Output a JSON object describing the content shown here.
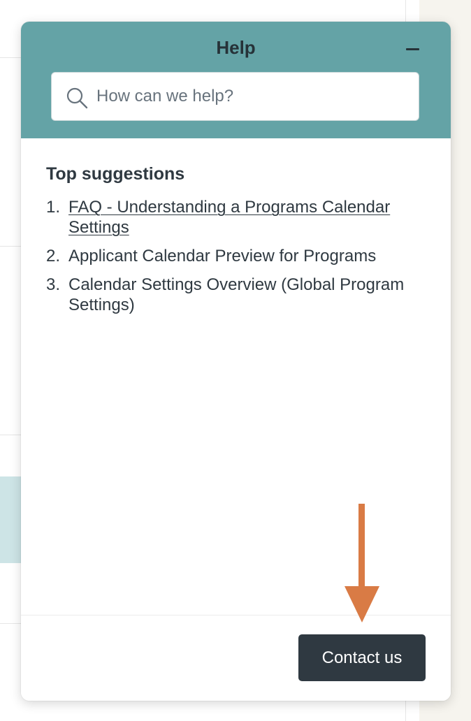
{
  "help_widget": {
    "title": "Help",
    "search": {
      "placeholder": "How can we help?",
      "value": ""
    },
    "suggestions_title": "Top suggestions",
    "suggestions": [
      {
        "number": "1.",
        "label": "FAQ - Understanding a Programs Calendar Settings"
      },
      {
        "number": "2.",
        "label": "Applicant Calendar Preview for Programs"
      },
      {
        "number": "3.",
        "label": "Calendar Settings Overview (Global Program Settings)"
      }
    ],
    "contact_button_label": "Contact us",
    "icons": {
      "search": "search-icon",
      "minimize": "minimize-icon",
      "annotation": "arrow-down-icon"
    }
  },
  "colors": {
    "header_bg": "#64a3a6",
    "button_bg": "#2f3941",
    "annotation_arrow": "#d97b45",
    "background_highlight": "#cde4e6"
  }
}
